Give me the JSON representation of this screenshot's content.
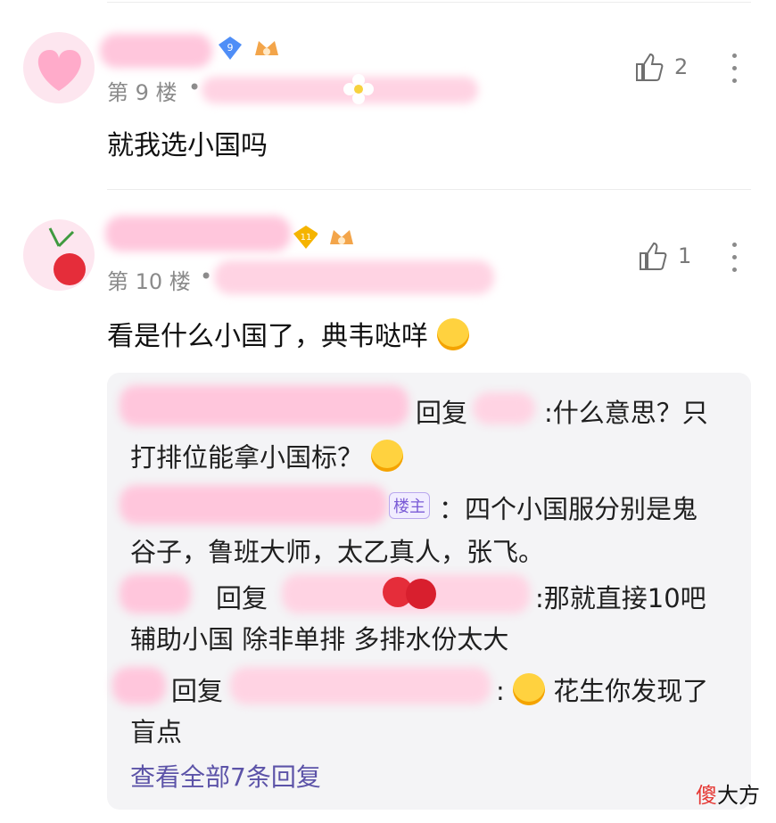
{
  "comments": [
    {
      "floor": "第 9 楼",
      "level": "9",
      "text": "就我选小国吗",
      "likes": "2"
    },
    {
      "floor": "第 10 楼",
      "level": "11",
      "text": "看是什么小国了，典韦哒咩",
      "likes": "1"
    }
  ],
  "replies": {
    "r1": {
      "reply_word": "回复",
      "text": ":什么意思？只",
      "cont": "打排位能拿小国标？"
    },
    "r2": {
      "tag": "楼主",
      "text": "：四个小国服分别是鬼",
      "cont": "谷子，鲁班大师，太乙真人，张飞。"
    },
    "r3": {
      "reply_word": "回复",
      "text": ":那就直接10吧",
      "cont": "辅助小国 除非单排 多排水份太大"
    },
    "r4": {
      "reply_word": "回复",
      "text": ":",
      "text2": "花生你发现了",
      "cont": "盲点"
    },
    "view_all": "查看全部7条回复"
  },
  "watermark": {
    "first": "傻",
    "rest": "大方"
  },
  "colors": {
    "pink": "#ffc6dc",
    "blue_badge": "#4f8ef7",
    "gold_badge": "#f5b400",
    "link": "#5c53a8",
    "watermark_red": "#e53935"
  }
}
